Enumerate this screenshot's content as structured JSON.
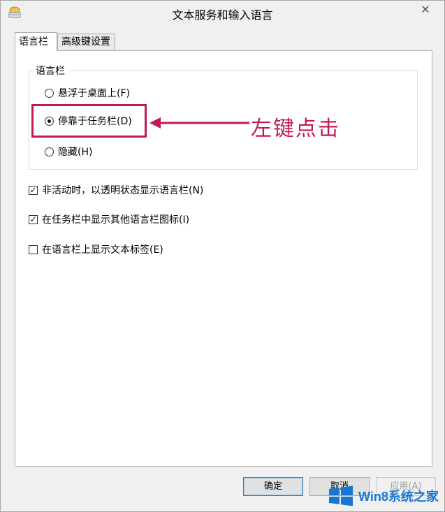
{
  "window": {
    "title": "文本服务和输入语言"
  },
  "tabs": [
    {
      "label": "语言栏",
      "active": true
    },
    {
      "label": "高级键设置",
      "active": false
    }
  ],
  "language_bar_group": {
    "label": "语言栏",
    "options": [
      {
        "label": "悬浮于桌面上(F)",
        "checked": false
      },
      {
        "label": "停靠于任务栏(D)",
        "checked": true
      },
      {
        "label": "隐藏(H)",
        "checked": false
      }
    ]
  },
  "checkboxes": [
    {
      "label": "非活动时，以透明状态显示语言栏(N)",
      "checked": true
    },
    {
      "label": "在任务栏中显示其他语言栏图标(I)",
      "checked": true
    },
    {
      "label": "在语言栏上显示文本标签(E)",
      "checked": false
    }
  ],
  "annotation": {
    "text": "左键点击",
    "color": "#c2185b"
  },
  "buttons": {
    "ok": "确定",
    "cancel": "取消",
    "apply": "应用(A)"
  },
  "watermark": {
    "text": "Win8系统之家",
    "color": "#1976d2"
  }
}
